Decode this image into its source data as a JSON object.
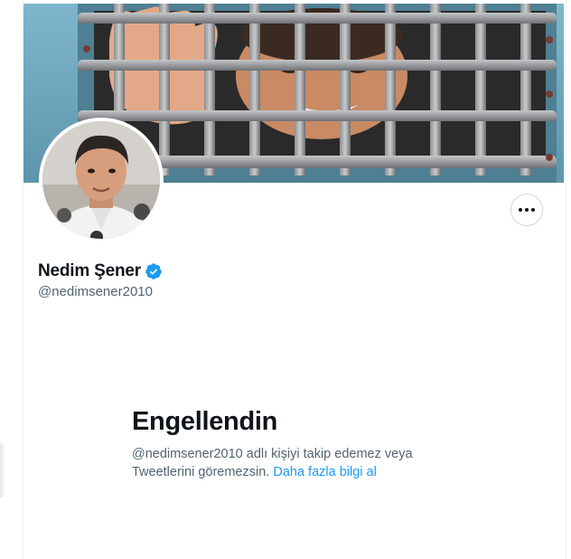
{
  "profile": {
    "display_name": "Nedim Şener",
    "handle": "@nedimsener2010",
    "verified": true
  },
  "blocked": {
    "title": "Engellendin",
    "desc_before": "@nedimsener2010 adlı kişiyi takip edemez veya Tweetlerini göremezsin. ",
    "link_label": "Daha fazla bilgi al"
  },
  "icons": {
    "more": "more-horizontal-icon",
    "verified": "verified-badge-icon"
  },
  "colors": {
    "accent": "#1d9bf0",
    "text_primary": "#0f1419",
    "text_secondary": "#536471",
    "border": "#cfd9de"
  }
}
